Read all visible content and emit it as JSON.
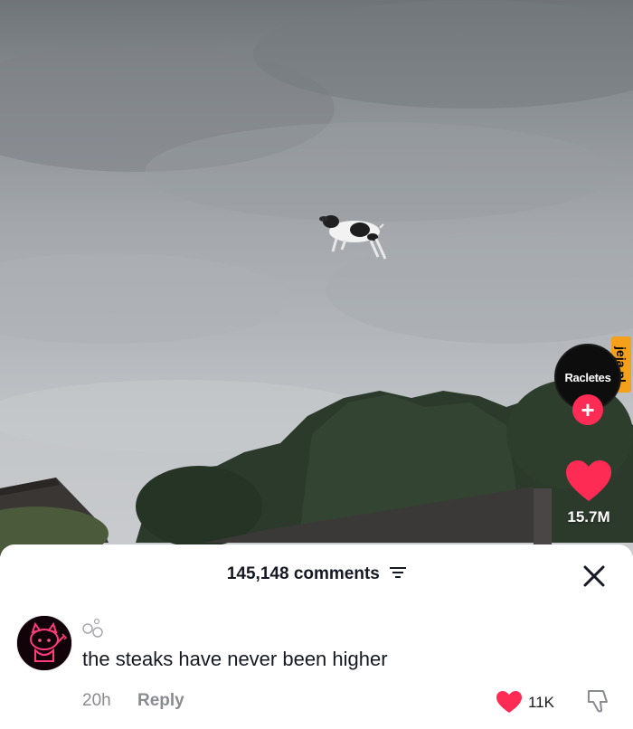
{
  "video": {
    "creator_name": "Racletes",
    "follow_symbol": "+",
    "like_count": "15.7M",
    "watermark": "jeja.pl"
  },
  "comments": {
    "header": "145,148 comments",
    "items": [
      {
        "username_glyph": "°∘°",
        "text": "the steaks have never been higher",
        "time": "20h",
        "reply_label": "Reply",
        "likes": "11K"
      }
    ]
  },
  "colors": {
    "accent": "#fe2c55",
    "text": "#161823",
    "muted": "#8a8b91"
  },
  "icons": [
    "filter-icon",
    "close-icon",
    "heart-icon",
    "dislike-icon",
    "plus-icon"
  ]
}
